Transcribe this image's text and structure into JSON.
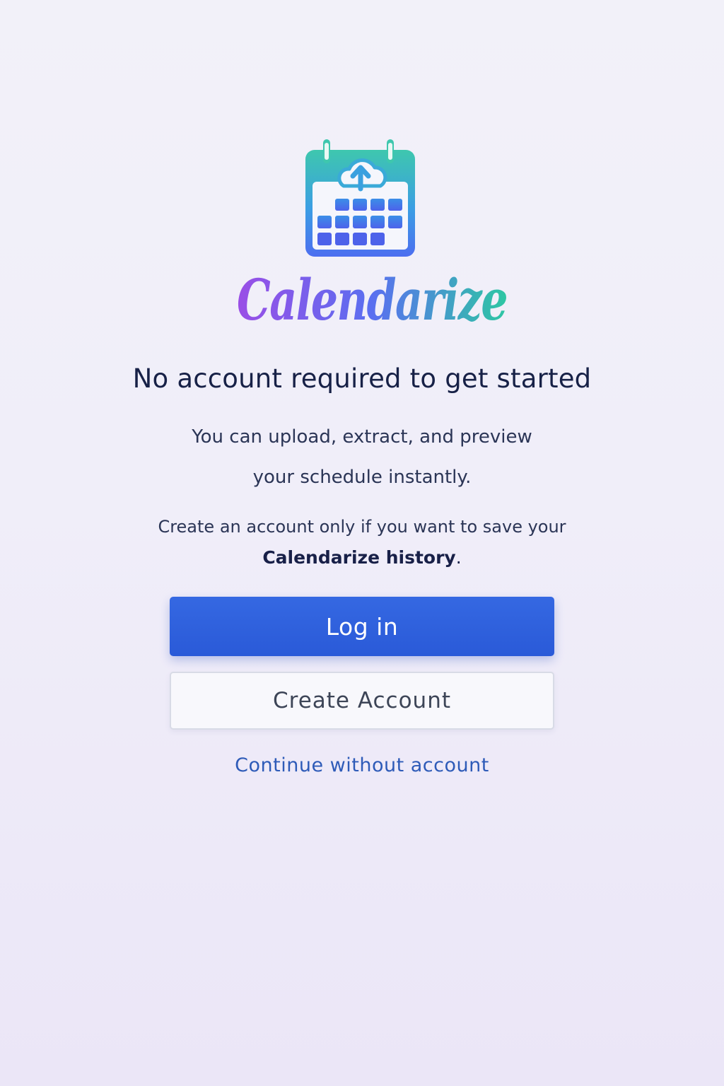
{
  "app": {
    "wordmark": "Calendarize",
    "logo_icon": "calendar-upload-icon"
  },
  "main": {
    "heading": "No account required to get started",
    "line1": "You can upload, extract, and preview",
    "line2": "your schedule instantly.",
    "line3": "Create an account only if you want to save your",
    "line4_bold": "Calendarize history",
    "line4_tail": "."
  },
  "actions": {
    "login_label": "Log in",
    "create_label": "Create Account",
    "continue_label": "Continue without account"
  },
  "colors": {
    "primary": "#2d5edc",
    "link": "#2e5bb8",
    "heading": "#172147",
    "wordmark_gradient": [
      "#9a4ee6",
      "#5a6ff0",
      "#2ec7a3"
    ],
    "icon_gradient": [
      "#3ec7ae",
      "#4c6ef0"
    ]
  }
}
